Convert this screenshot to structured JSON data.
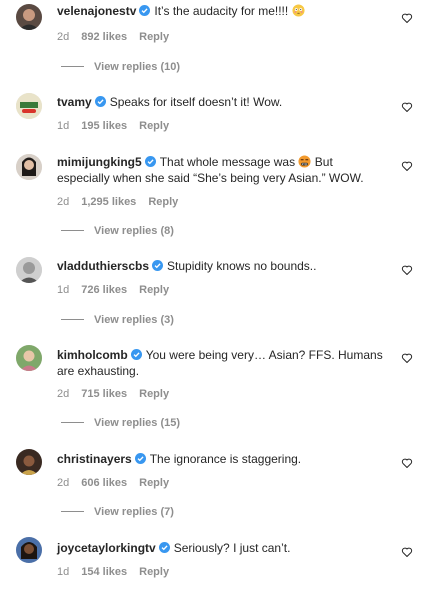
{
  "comments": [
    {
      "username": "velenajonestv",
      "text": "It’s the audacity for me!!!!",
      "emoji": "flushed-face",
      "time": "2d",
      "likes": "892 likes",
      "reply": "Reply",
      "view_replies": "View replies (10)"
    },
    {
      "username": "tvamy",
      "text": "Speaks for itself doesn’t it! Wow.",
      "time": "1d",
      "likes": "195 likes",
      "reply": "Reply"
    },
    {
      "username": "mimijungking5",
      "text_before": "That whole message was",
      "emoji": "face-with-symbols",
      "text_after": "But especially when she said “She’s being very Asian.” WOW.",
      "time": "2d",
      "likes": "1,295 likes",
      "reply": "Reply",
      "view_replies": "View replies (8)"
    },
    {
      "username": "vladduthierscbs",
      "text": "Stupidity knows no bounds..",
      "time": "1d",
      "likes": "726 likes",
      "reply": "Reply",
      "view_replies": "View replies (3)"
    },
    {
      "username": "kimholcomb",
      "text": "You were being very… Asian? FFS. Humans are exhausting.",
      "time": "2d",
      "likes": "715 likes",
      "reply": "Reply",
      "view_replies": "View replies (15)"
    },
    {
      "username": "christinayers",
      "text": "The ignorance is staggering.",
      "time": "2d",
      "likes": "606 likes",
      "reply": "Reply",
      "view_replies": "View replies (7)"
    },
    {
      "username": "joycetaylorkingtv",
      "text": "Seriously? I just can’t.",
      "time": "1d",
      "likes": "154 likes",
      "reply": "Reply"
    }
  ],
  "colors": {
    "verified": "#3897f0",
    "muted": "#8e8e8e",
    "text": "#262626"
  },
  "icons": {
    "verified": "verified-badge-icon",
    "like": "heart-outline-icon"
  }
}
